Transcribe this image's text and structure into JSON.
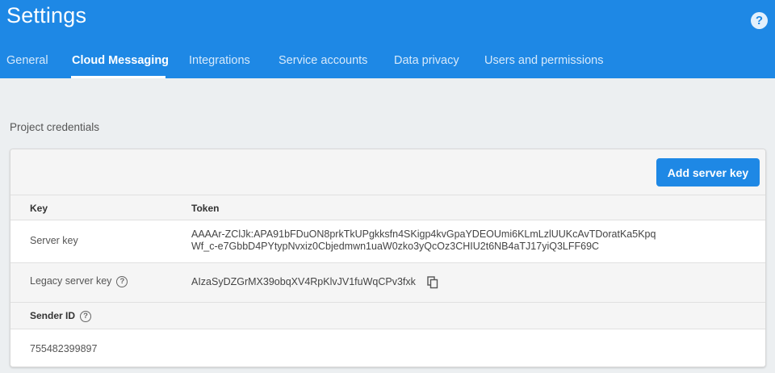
{
  "header": {
    "title": "Settings",
    "help_icon": "?",
    "tabs": [
      {
        "label": "General"
      },
      {
        "label": "Cloud Messaging",
        "active": true
      },
      {
        "label": "Integrations"
      },
      {
        "label": "Service accounts"
      },
      {
        "label": "Data privacy"
      },
      {
        "label": "Users and permissions"
      }
    ]
  },
  "credentials": {
    "section_label": "Project credentials",
    "add_button_label": "Add server key",
    "columns": {
      "key": "Key",
      "token": "Token"
    },
    "rows": [
      {
        "key": "Server key",
        "token_line1": "AAAAr-ZClJk:APA91bFDuON8prkTkUPgkksfn4SKigp4kvGpaYDEOUmi6KLmLzlUUKcAvTDoratKa5Kpq",
        "token_line2": "Wf_c-e7GbbD4PYtypNvxiz0Cbjedmwn1uaW0zko3yQcOz3CHIU2t6NB4aTJ17yiQ3LFF69C"
      },
      {
        "key": "Legacy server key",
        "token": "AIzaSyDZGrMX39obqXV4RpKlvJV1fuWqCPv3fxk"
      }
    ],
    "sender": {
      "label": "Sender ID",
      "value": "755482399897"
    }
  },
  "colors": {
    "accent": "#1e88e5",
    "background": "#eceff1"
  },
  "icons": {
    "help": "help-circle-icon",
    "copy": "copy-icon"
  }
}
